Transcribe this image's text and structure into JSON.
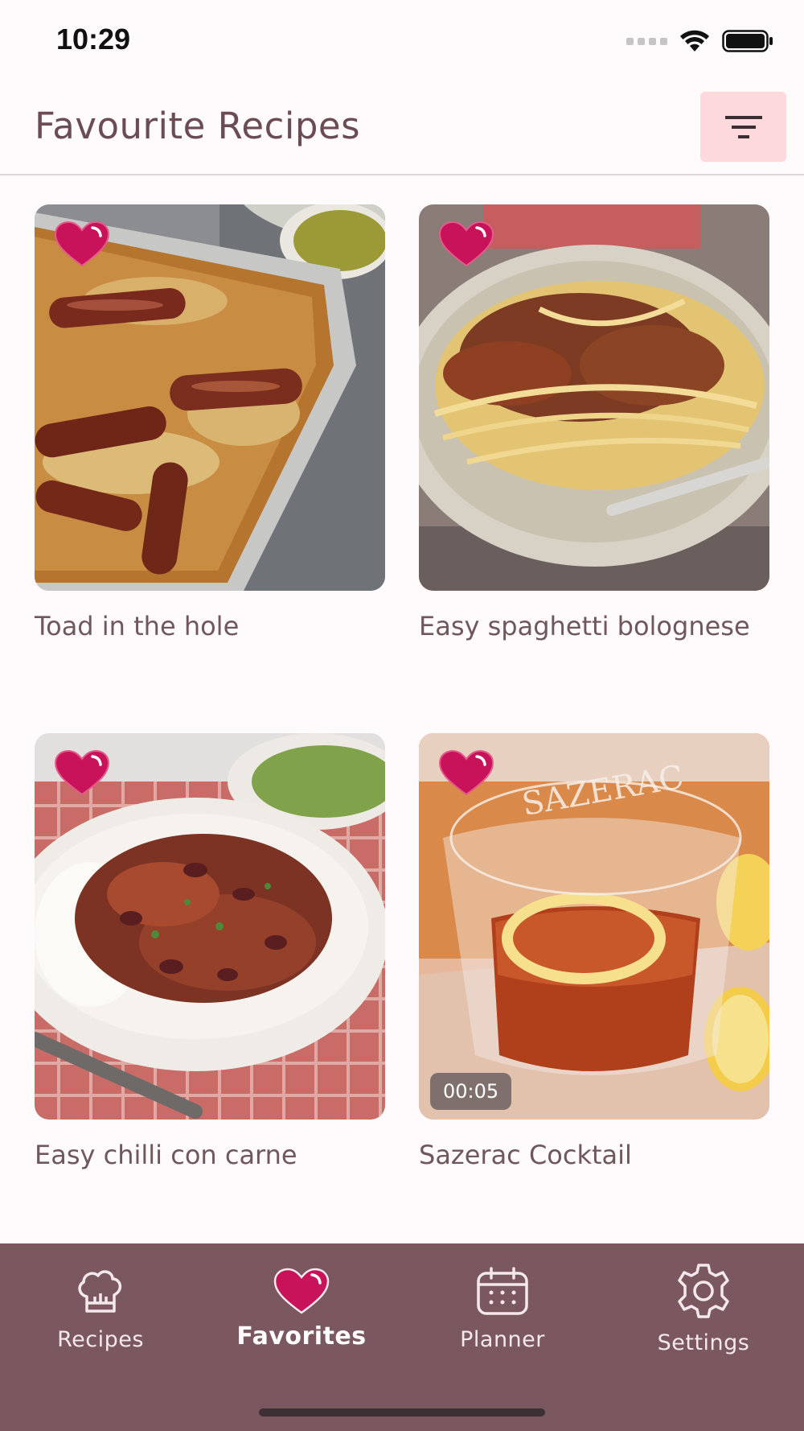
{
  "status_bar": {
    "time": "10:29"
  },
  "header": {
    "title": "Favourite Recipes"
  },
  "recipes": [
    {
      "name": "Toad in the hole",
      "favorite": true
    },
    {
      "name": "Easy spaghetti bolognese",
      "favorite": true
    },
    {
      "name": "Easy chilli con carne",
      "favorite": true
    },
    {
      "name": "Sazerac Cocktail",
      "favorite": true,
      "duration": "00:05"
    }
  ],
  "nav": {
    "items": [
      {
        "label": "Recipes",
        "icon": "chef-hat-icon"
      },
      {
        "label": "Favorites",
        "icon": "heart-icon",
        "active": true
      },
      {
        "label": "Planner",
        "icon": "calendar-icon"
      },
      {
        "label": "Settings",
        "icon": "gear-icon"
      }
    ]
  },
  "colors": {
    "accent": "#c8135a",
    "nav_background": "#7b5860",
    "filter_button": "#fdd9de"
  }
}
